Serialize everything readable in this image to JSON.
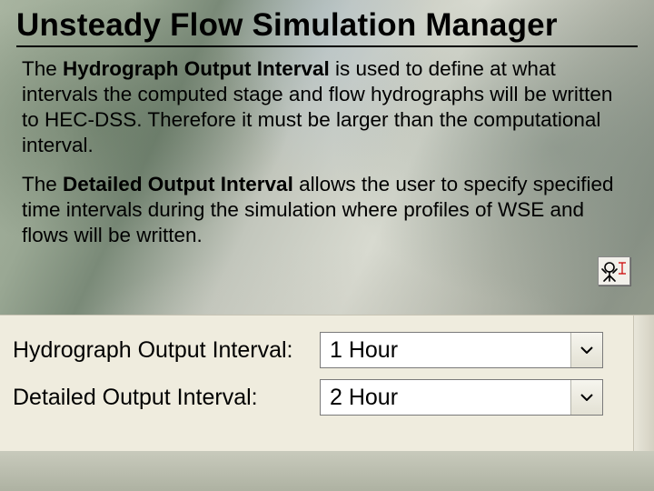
{
  "title": "Unsteady Flow Simulation Manager",
  "para1": {
    "pre": "The ",
    "bold": "Hydrograph Output Interval",
    "post": " is used to define at what intervals the computed stage and flow hydrographs will be written to HEC-DSS.  Therefore it must be larger than the computational interval."
  },
  "para2": {
    "pre": "The ",
    "bold": "Detailed Output Interval",
    "post": " allows the user to specify specified time intervals during the simulation where profiles of WSE and flows will be written."
  },
  "panel": {
    "rows": [
      {
        "label": "Hydrograph Output Interval:",
        "value": "1 Hour"
      },
      {
        "label": "Detailed Output Interval:",
        "value": "2 Hour"
      }
    ]
  }
}
